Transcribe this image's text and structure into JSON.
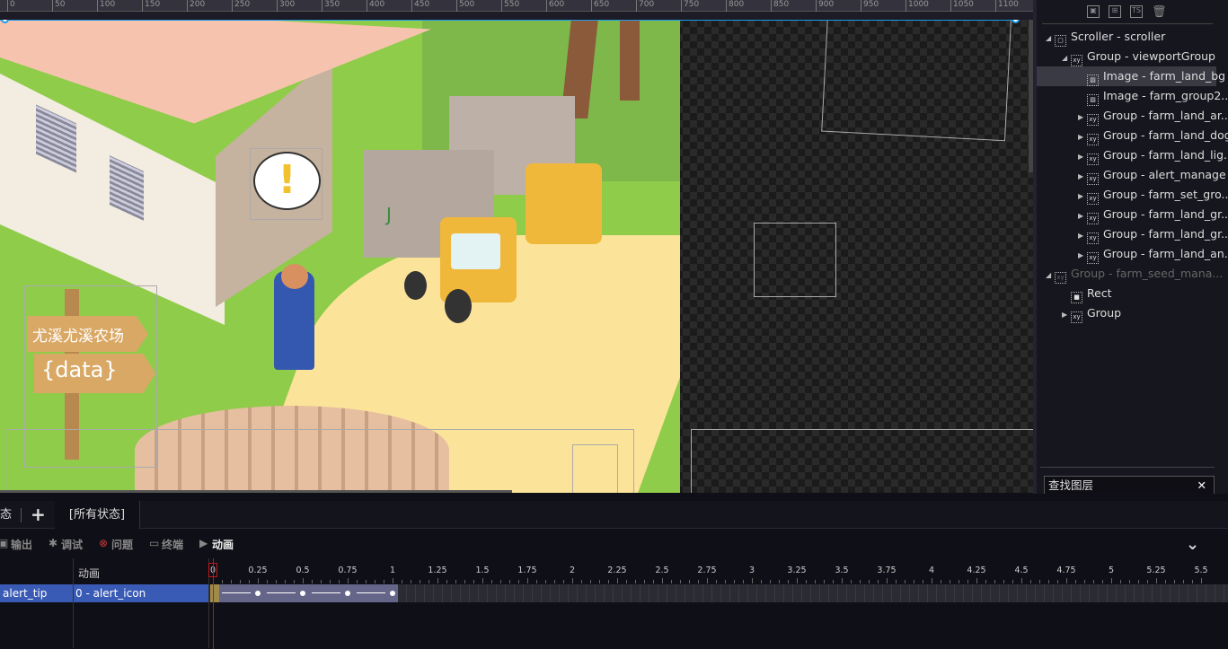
{
  "ruler": {
    "labels": [
      "0",
      "50",
      "100",
      "150",
      "200",
      "250",
      "300",
      "350",
      "400",
      "450",
      "500",
      "550",
      "600",
      "650",
      "700",
      "750",
      "800",
      "850",
      "900",
      "950",
      "1000",
      "1050",
      "1100"
    ]
  },
  "scene": {
    "sign_title": "尤溪尤溪农场",
    "sign_data": "{data}",
    "alert_symbol": "!",
    "truck_logo": "J"
  },
  "layers": {
    "toolbar_icons": [
      "fit-icon",
      "align-icon",
      "typescript-file-icon",
      "trash-icon"
    ],
    "items": [
      {
        "label": "Scroller - scroller",
        "expanded": true,
        "type": "scroller"
      },
      {
        "label": "Group - viewportGroup",
        "expanded": true,
        "type": "group"
      },
      {
        "label": "Image - farm_land_bg",
        "type": "image",
        "selected": true
      },
      {
        "label": "Image - farm_group2...",
        "type": "image"
      },
      {
        "label": "Group - farm_land_ar...",
        "type": "group"
      },
      {
        "label": "Group - farm_land_dog",
        "type": "group"
      },
      {
        "label": "Group - farm_land_lig...",
        "type": "group"
      },
      {
        "label": "Group - alert_manage",
        "type": "group"
      },
      {
        "label": "Group - farm_set_gro...",
        "type": "group"
      },
      {
        "label": "Group - farm_land_gr...",
        "type": "group"
      },
      {
        "label": "Group - farm_land_gr...",
        "type": "group"
      },
      {
        "label": "Group - farm_land_an...",
        "type": "group"
      },
      {
        "label": "Group - farm_seed_mana...",
        "expanded": true,
        "type": "group",
        "dim": true
      },
      {
        "label": "Rect",
        "type": "rect"
      },
      {
        "label": "Group",
        "type": "group"
      }
    ],
    "search_placeholder": "查找图层",
    "search_clear": "✕"
  },
  "states": {
    "partial_tab": "态",
    "add": "+",
    "all_states": "[所有状态]"
  },
  "panel_tabs": [
    {
      "label": "输出"
    },
    {
      "label": "调试"
    },
    {
      "label": "问题"
    },
    {
      "label": "终端"
    },
    {
      "label": "动画",
      "active": true
    }
  ],
  "collapse_icon": "⌄",
  "timeline": {
    "column_header": "动画",
    "ticks": [
      "0",
      "0.25",
      "0.5",
      "0.75",
      "1",
      "1.25",
      "1.5",
      "1.75",
      "2",
      "2.25",
      "2.5",
      "2.75",
      "3",
      "3.25",
      "3.5",
      "3.75",
      "4",
      "4.25",
      "4.5",
      "4.75",
      "5",
      "5.25",
      "5.5"
    ],
    "row_target": "alert_tip",
    "row_animation": "0 - alert_icon",
    "keyframes": [
      0,
      0.25,
      0.5,
      0.75,
      1
    ],
    "duration": 1,
    "playhead": 0,
    "colors": {
      "row_selected": "#3a5bb5",
      "clip": "#65658a",
      "playhead": "#c0161c"
    }
  }
}
